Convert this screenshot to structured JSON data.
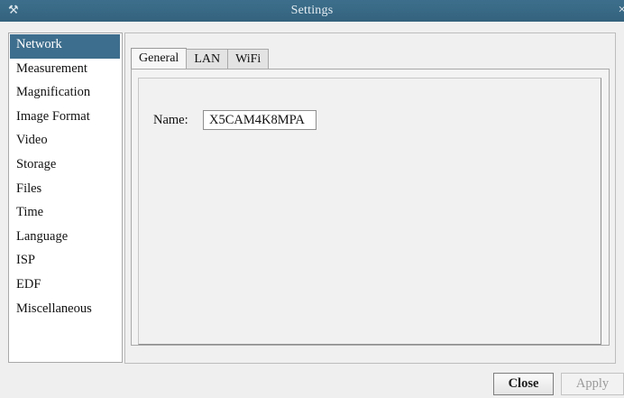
{
  "window": {
    "title": "Settings",
    "icon": "tools-icon",
    "close_glyph": "×"
  },
  "sidebar": {
    "selected": "Network",
    "items": [
      {
        "label": "Network"
      },
      {
        "label": "Measurement"
      },
      {
        "label": "Magnification"
      },
      {
        "label": "Image Format"
      },
      {
        "label": "Video"
      },
      {
        "label": "Storage"
      },
      {
        "label": "Files"
      },
      {
        "label": "Time"
      },
      {
        "label": "Language"
      },
      {
        "label": "ISP"
      },
      {
        "label": "EDF"
      },
      {
        "label": "Miscellaneous"
      }
    ]
  },
  "tabs": {
    "active": "General",
    "items": [
      {
        "label": "General"
      },
      {
        "label": "LAN"
      },
      {
        "label": "WiFi"
      }
    ]
  },
  "general": {
    "name_label": "Name:",
    "name_value": "X5CAM4K8MPA"
  },
  "footer": {
    "close_label": "Close",
    "apply_label": "Apply"
  },
  "colors": {
    "titlebar": "#3d6f8c",
    "selection": "#3e6e8d",
    "background": "#efefef"
  }
}
